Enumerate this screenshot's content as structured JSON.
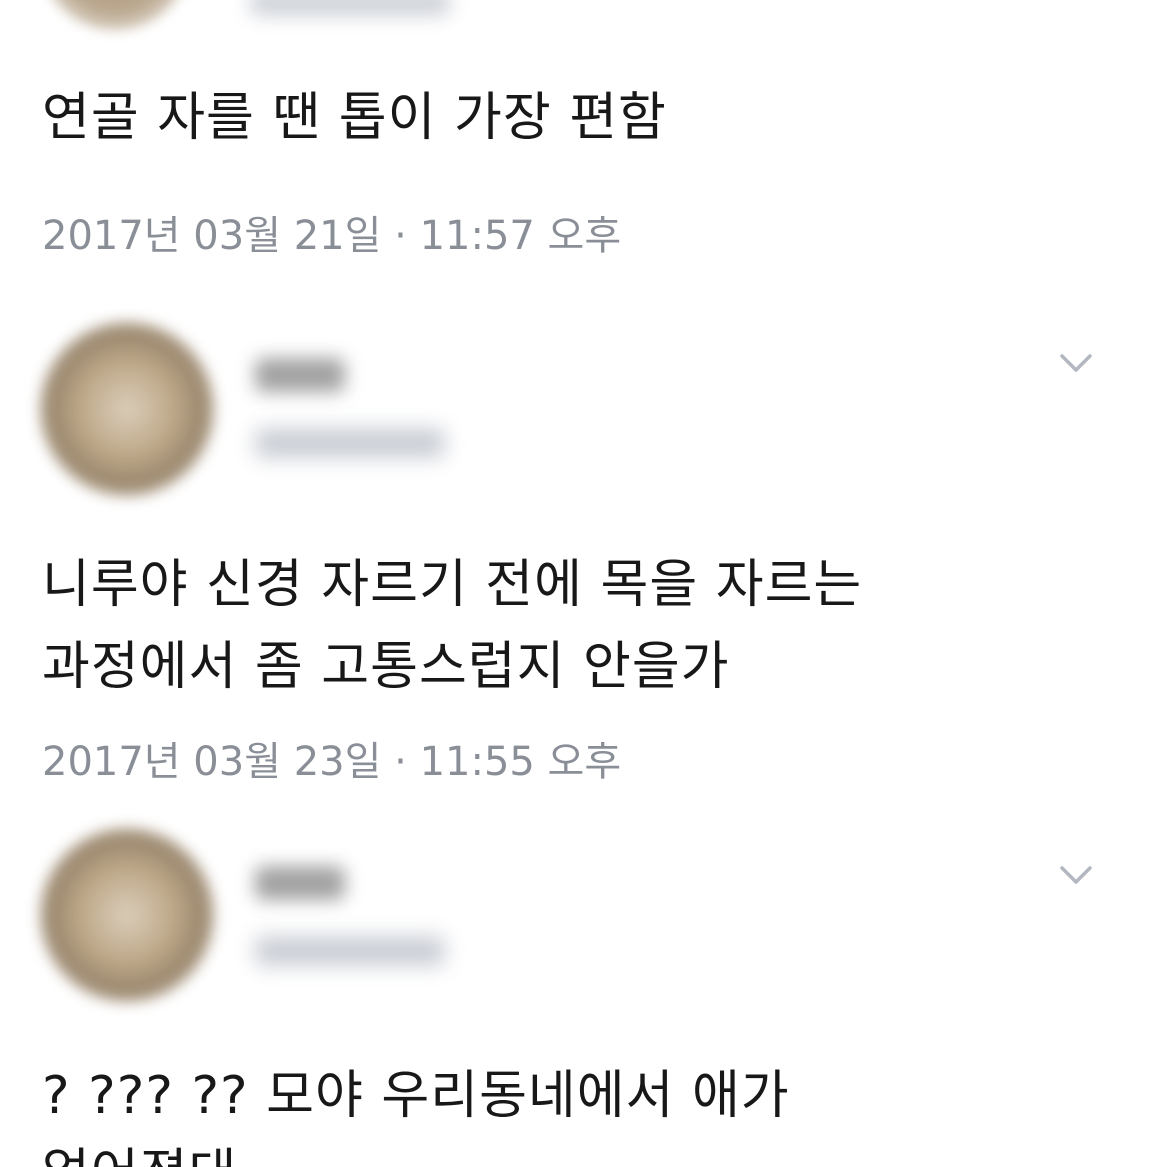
{
  "tweets": [
    {
      "text_lines": [
        "연골 자를 땐 톱이 가장 편함"
      ],
      "timestamp": "2017년 03월 21일 · 11:57 오후"
    },
    {
      "text_lines": [
        "니루야 신경 자르기 전에 목을 자르는",
        "과정에서 좀 고통스럽지 안을가"
      ],
      "timestamp": "2017년 03월 23일 · 11:55 오후"
    },
    {
      "text_lines": [
        "? ??? ?? 모야 우리동네에서 애가",
        "없어졌대"
      ]
    }
  ],
  "icons": {
    "avatar": "avatar",
    "chevron": "chevron-down-icon"
  },
  "colors": {
    "text": "#181818",
    "timestamp": "#8a8f97",
    "chevron": "#b3b8c0"
  }
}
